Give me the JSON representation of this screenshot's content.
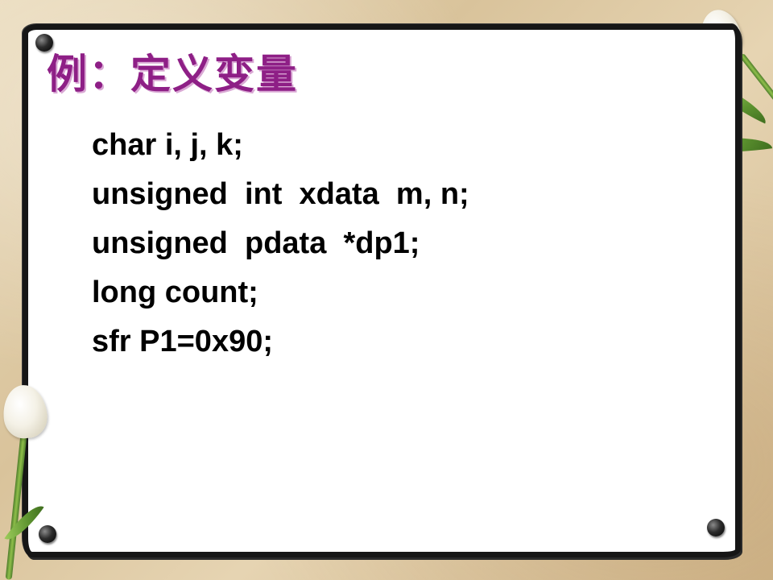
{
  "slide": {
    "title": "例：定义变量",
    "code_lines": [
      "char i, j, k;",
      "unsigned  int  xdata  m, n;",
      "unsigned  pdata  *dp1;",
      "long count;",
      "sfr P1=0x90;"
    ]
  },
  "colors": {
    "title": "#8e1f86",
    "title_shadow": "#d9a8d4",
    "code_text": "#000000",
    "card_background": "#ffffff",
    "card_border": "#161616"
  },
  "icons": [
    "pushpin-icon",
    "tulip-icon"
  ]
}
